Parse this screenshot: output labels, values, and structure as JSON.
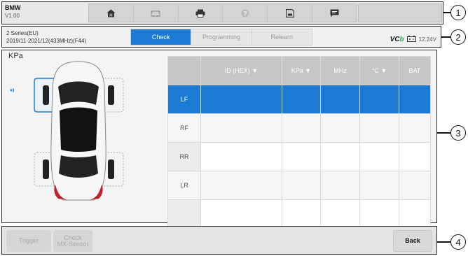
{
  "app": {
    "brand": "BMW",
    "version": "V1.00"
  },
  "toolbar": {
    "items": [
      {
        "name": "home",
        "icon": "home-icon"
      },
      {
        "name": "vehicle-swap",
        "icon": "car-swap-icon"
      },
      {
        "name": "print",
        "icon": "printer-icon"
      },
      {
        "name": "help",
        "icon": "help-icon"
      },
      {
        "name": "save",
        "icon": "save-icon"
      },
      {
        "name": "message",
        "icon": "chat-icon"
      }
    ]
  },
  "info_bar": {
    "vehicle_line1": "2 Series(EU)",
    "vehicle_line2": "2019/11-2021/12(433MHz)(F44)",
    "tabs": [
      "Check",
      "Programming",
      "Relearn"
    ],
    "active_tab": "Check",
    "vci_label_prefix": "VC",
    "vci_label_suffix": "b",
    "battery_icon": "battery-icon",
    "voltage": "12.24V"
  },
  "main": {
    "pressure_unit": "KPa",
    "signal_icon": "signal-wave-icon",
    "table": {
      "headers": [
        "",
        "ID (HEX) ▼",
        "KPa ▼",
        "MHz",
        "°C ▼",
        "BAT"
      ],
      "rows": [
        {
          "pos": "LF",
          "selected": true
        },
        {
          "pos": "RF",
          "selected": false
        },
        {
          "pos": "RR",
          "selected": false
        },
        {
          "pos": "LR",
          "selected": false
        },
        {
          "pos": "",
          "selected": false
        }
      ]
    }
  },
  "bottom_bar": {
    "trigger": "Trigger",
    "check_line1": "Check",
    "check_line2": "MX-Sensor",
    "back": "Back"
  },
  "callouts": [
    "1",
    "2",
    "3",
    "4"
  ],
  "colors": {
    "accent": "#1a7ad4",
    "vci_green": "#2fb140",
    "header_gray": "#c6c6c6"
  }
}
